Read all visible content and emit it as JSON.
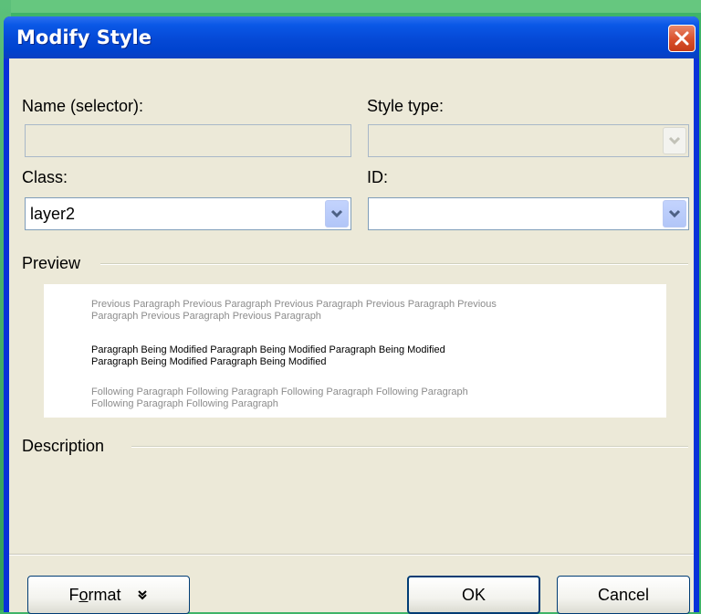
{
  "dialog": {
    "title": "Modify Style"
  },
  "form": {
    "name_label": "Name (selector):",
    "name_value": "",
    "style_type_label": "Style type:",
    "style_type_value": "",
    "class_label": "Class:",
    "class_value": "layer2",
    "id_label": "ID:",
    "id_value": ""
  },
  "preview": {
    "label": "Preview",
    "previous_line1": "Previous Paragraph Previous Paragraph Previous Paragraph Previous Paragraph Previous",
    "previous_line2": "Paragraph Previous Paragraph Previous Paragraph",
    "modified_line1": "Paragraph Being Modified Paragraph Being Modified Paragraph Being Modified",
    "modified_line2": "Paragraph Being Modified Paragraph Being Modified",
    "following_line1": "Following Paragraph Following Paragraph Following Paragraph Following Paragraph",
    "following_line2": "Following Paragraph Following Paragraph"
  },
  "description": {
    "label": "Description"
  },
  "buttons": {
    "format_label": "Format",
    "format_accel": "o",
    "ok_label": "OK",
    "cancel_label": "Cancel"
  },
  "icons": {
    "close": "close-icon",
    "dropdown": "chevron-down-icon",
    "format_menu": "double-chevron-down-icon"
  },
  "colors": {
    "titlebar": "#0a58e6",
    "close_button": "#d9502b",
    "dialog_bg": "#ece9d8",
    "field_border": "#7f9db9"
  }
}
